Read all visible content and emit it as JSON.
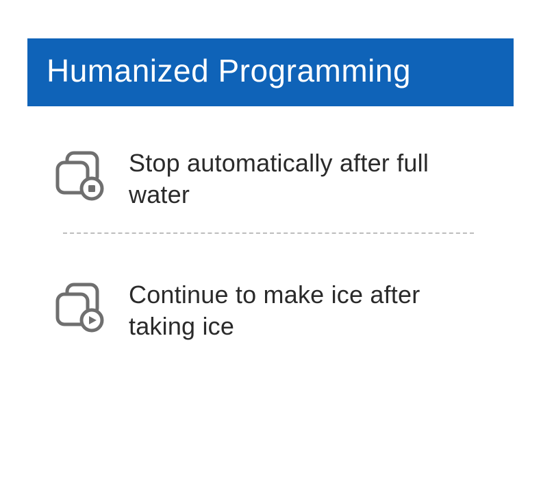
{
  "header": {
    "title": "Humanized Programming"
  },
  "features": [
    {
      "icon": "stop-icon",
      "text": "Stop automatically after full water"
    },
    {
      "icon": "play-icon",
      "text": "Continue to make ice after taking ice"
    }
  ],
  "colors": {
    "header_bg": "#0f63b8",
    "icon_stroke": "#6f6f6f"
  }
}
